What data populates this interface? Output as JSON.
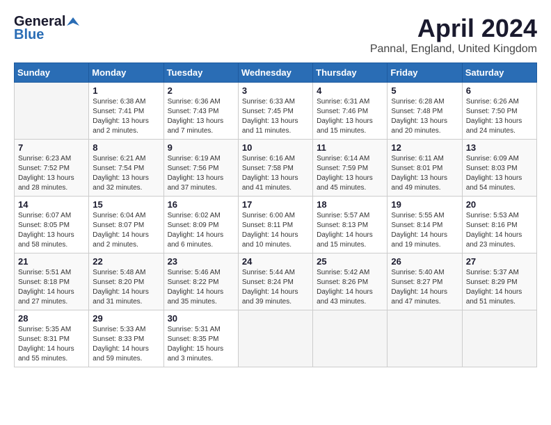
{
  "logo": {
    "general": "General",
    "blue": "Blue"
  },
  "header": {
    "month": "April 2024",
    "location": "Pannal, England, United Kingdom"
  },
  "weekdays": [
    "Sunday",
    "Monday",
    "Tuesday",
    "Wednesday",
    "Thursday",
    "Friday",
    "Saturday"
  ],
  "weeks": [
    [
      {
        "day": "",
        "info": ""
      },
      {
        "day": "1",
        "sunrise": "Sunrise: 6:38 AM",
        "sunset": "Sunset: 7:41 PM",
        "daylight": "Daylight: 13 hours and 2 minutes."
      },
      {
        "day": "2",
        "sunrise": "Sunrise: 6:36 AM",
        "sunset": "Sunset: 7:43 PM",
        "daylight": "Daylight: 13 hours and 7 minutes."
      },
      {
        "day": "3",
        "sunrise": "Sunrise: 6:33 AM",
        "sunset": "Sunset: 7:45 PM",
        "daylight": "Daylight: 13 hours and 11 minutes."
      },
      {
        "day": "4",
        "sunrise": "Sunrise: 6:31 AM",
        "sunset": "Sunset: 7:46 PM",
        "daylight": "Daylight: 13 hours and 15 minutes."
      },
      {
        "day": "5",
        "sunrise": "Sunrise: 6:28 AM",
        "sunset": "Sunset: 7:48 PM",
        "daylight": "Daylight: 13 hours and 20 minutes."
      },
      {
        "day": "6",
        "sunrise": "Sunrise: 6:26 AM",
        "sunset": "Sunset: 7:50 PM",
        "daylight": "Daylight: 13 hours and 24 minutes."
      }
    ],
    [
      {
        "day": "7",
        "sunrise": "Sunrise: 6:23 AM",
        "sunset": "Sunset: 7:52 PM",
        "daylight": "Daylight: 13 hours and 28 minutes."
      },
      {
        "day": "8",
        "sunrise": "Sunrise: 6:21 AM",
        "sunset": "Sunset: 7:54 PM",
        "daylight": "Daylight: 13 hours and 32 minutes."
      },
      {
        "day": "9",
        "sunrise": "Sunrise: 6:19 AM",
        "sunset": "Sunset: 7:56 PM",
        "daylight": "Daylight: 13 hours and 37 minutes."
      },
      {
        "day": "10",
        "sunrise": "Sunrise: 6:16 AM",
        "sunset": "Sunset: 7:58 PM",
        "daylight": "Daylight: 13 hours and 41 minutes."
      },
      {
        "day": "11",
        "sunrise": "Sunrise: 6:14 AM",
        "sunset": "Sunset: 7:59 PM",
        "daylight": "Daylight: 13 hours and 45 minutes."
      },
      {
        "day": "12",
        "sunrise": "Sunrise: 6:11 AM",
        "sunset": "Sunset: 8:01 PM",
        "daylight": "Daylight: 13 hours and 49 minutes."
      },
      {
        "day": "13",
        "sunrise": "Sunrise: 6:09 AM",
        "sunset": "Sunset: 8:03 PM",
        "daylight": "Daylight: 13 hours and 54 minutes."
      }
    ],
    [
      {
        "day": "14",
        "sunrise": "Sunrise: 6:07 AM",
        "sunset": "Sunset: 8:05 PM",
        "daylight": "Daylight: 13 hours and 58 minutes."
      },
      {
        "day": "15",
        "sunrise": "Sunrise: 6:04 AM",
        "sunset": "Sunset: 8:07 PM",
        "daylight": "Daylight: 14 hours and 2 minutes."
      },
      {
        "day": "16",
        "sunrise": "Sunrise: 6:02 AM",
        "sunset": "Sunset: 8:09 PM",
        "daylight": "Daylight: 14 hours and 6 minutes."
      },
      {
        "day": "17",
        "sunrise": "Sunrise: 6:00 AM",
        "sunset": "Sunset: 8:11 PM",
        "daylight": "Daylight: 14 hours and 10 minutes."
      },
      {
        "day": "18",
        "sunrise": "Sunrise: 5:57 AM",
        "sunset": "Sunset: 8:13 PM",
        "daylight": "Daylight: 14 hours and 15 minutes."
      },
      {
        "day": "19",
        "sunrise": "Sunrise: 5:55 AM",
        "sunset": "Sunset: 8:14 PM",
        "daylight": "Daylight: 14 hours and 19 minutes."
      },
      {
        "day": "20",
        "sunrise": "Sunrise: 5:53 AM",
        "sunset": "Sunset: 8:16 PM",
        "daylight": "Daylight: 14 hours and 23 minutes."
      }
    ],
    [
      {
        "day": "21",
        "sunrise": "Sunrise: 5:51 AM",
        "sunset": "Sunset: 8:18 PM",
        "daylight": "Daylight: 14 hours and 27 minutes."
      },
      {
        "day": "22",
        "sunrise": "Sunrise: 5:48 AM",
        "sunset": "Sunset: 8:20 PM",
        "daylight": "Daylight: 14 hours and 31 minutes."
      },
      {
        "day": "23",
        "sunrise": "Sunrise: 5:46 AM",
        "sunset": "Sunset: 8:22 PM",
        "daylight": "Daylight: 14 hours and 35 minutes."
      },
      {
        "day": "24",
        "sunrise": "Sunrise: 5:44 AM",
        "sunset": "Sunset: 8:24 PM",
        "daylight": "Daylight: 14 hours and 39 minutes."
      },
      {
        "day": "25",
        "sunrise": "Sunrise: 5:42 AM",
        "sunset": "Sunset: 8:26 PM",
        "daylight": "Daylight: 14 hours and 43 minutes."
      },
      {
        "day": "26",
        "sunrise": "Sunrise: 5:40 AM",
        "sunset": "Sunset: 8:27 PM",
        "daylight": "Daylight: 14 hours and 47 minutes."
      },
      {
        "day": "27",
        "sunrise": "Sunrise: 5:37 AM",
        "sunset": "Sunset: 8:29 PM",
        "daylight": "Daylight: 14 hours and 51 minutes."
      }
    ],
    [
      {
        "day": "28",
        "sunrise": "Sunrise: 5:35 AM",
        "sunset": "Sunset: 8:31 PM",
        "daylight": "Daylight: 14 hours and 55 minutes."
      },
      {
        "day": "29",
        "sunrise": "Sunrise: 5:33 AM",
        "sunset": "Sunset: 8:33 PM",
        "daylight": "Daylight: 14 hours and 59 minutes."
      },
      {
        "day": "30",
        "sunrise": "Sunrise: 5:31 AM",
        "sunset": "Sunset: 8:35 PM",
        "daylight": "Daylight: 15 hours and 3 minutes."
      },
      {
        "day": "",
        "info": ""
      },
      {
        "day": "",
        "info": ""
      },
      {
        "day": "",
        "info": ""
      },
      {
        "day": "",
        "info": ""
      }
    ]
  ]
}
